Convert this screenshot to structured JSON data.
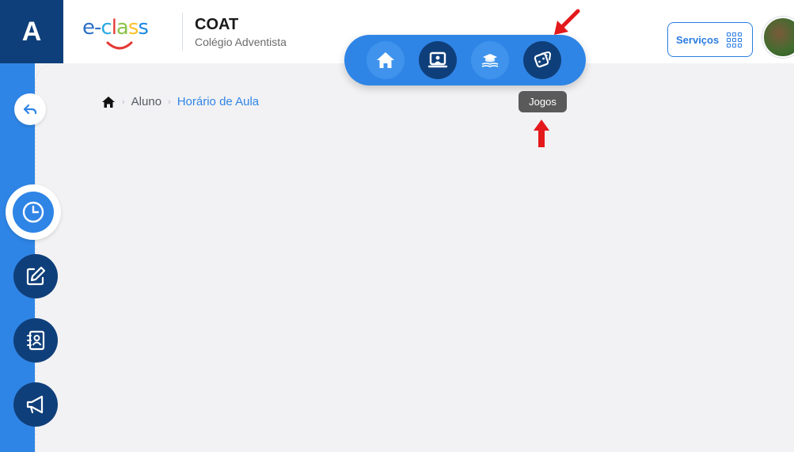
{
  "header": {
    "logo_letter": "A",
    "brand": {
      "part1": "e",
      "dash": "-",
      "c": "c",
      "l": "l",
      "a": "a",
      "s1": "s",
      "s2": "s"
    },
    "school_name": "COAT",
    "school_subtitle": "Colégio Adventista",
    "services_label": "Serviços"
  },
  "nav": {
    "items": [
      {
        "name": "home",
        "icon": "home-icon"
      },
      {
        "name": "classroom",
        "icon": "classroom-screen-icon"
      },
      {
        "name": "education",
        "icon": "graduation-book-icon"
      },
      {
        "name": "games",
        "icon": "dice-icon"
      }
    ],
    "tooltip": "Jogos"
  },
  "sidebar": {
    "items": [
      {
        "name": "back",
        "icon": "back-arrow-icon"
      },
      {
        "name": "schedule",
        "icon": "clock-icon"
      },
      {
        "name": "edit",
        "icon": "edit-icon"
      },
      {
        "name": "contacts",
        "icon": "contact-book-icon"
      },
      {
        "name": "announcements",
        "icon": "megaphone-icon"
      }
    ]
  },
  "breadcrumb": {
    "home_icon": "home-icon",
    "items": [
      "Aluno",
      "Horário de Aula"
    ]
  },
  "colors": {
    "primary": "#2f85e6",
    "dark": "#0f3f7a",
    "annotation": "#e3191c"
  }
}
